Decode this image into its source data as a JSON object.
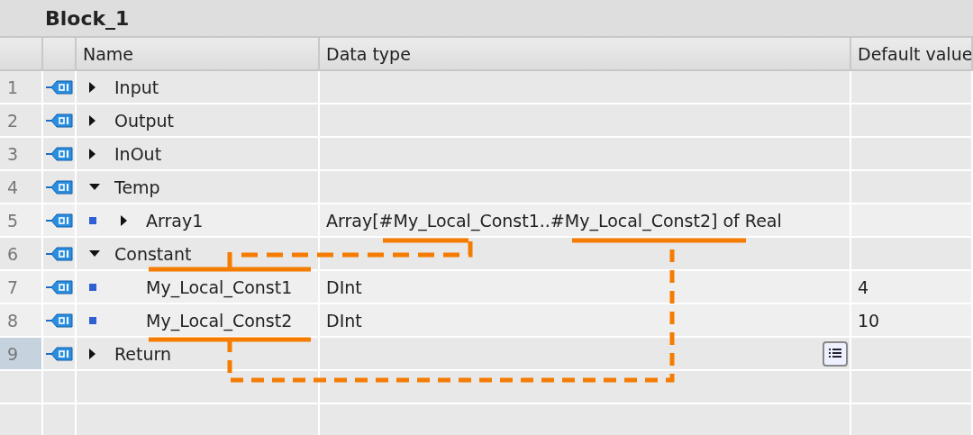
{
  "title": "Block_1",
  "columns": [
    "Name",
    "Data type",
    "Default value"
  ],
  "rows": [
    {
      "number": "1",
      "name": "Input",
      "expanded": false,
      "selected": false
    },
    {
      "number": "2",
      "name": "Output",
      "expanded": false,
      "selected": false
    },
    {
      "number": "3",
      "name": "InOut",
      "expanded": false,
      "selected": false
    },
    {
      "number": "4",
      "name": "Temp",
      "expanded": true,
      "selected": false,
      "children": [
        {
          "number": "5",
          "name": "Array1",
          "expanded": false,
          "selected": false,
          "data_type": "Array[#My_Local_Const1..#My_Local_Const2] of Real"
        }
      ]
    },
    {
      "number": "6",
      "name": "Constant",
      "expanded": true,
      "selected": false,
      "children": [
        {
          "number": "7",
          "name": "My_Local_Const1",
          "selected": false,
          "data_type": "DInt",
          "default_value": "4"
        },
        {
          "number": "8",
          "name": "My_Local_Const2",
          "selected": false,
          "data_type": "DInt",
          "default_value": "10"
        }
      ]
    },
    {
      "number": "9",
      "name": "Return",
      "expanded": false,
      "selected": true,
      "list_button": true
    }
  ]
}
